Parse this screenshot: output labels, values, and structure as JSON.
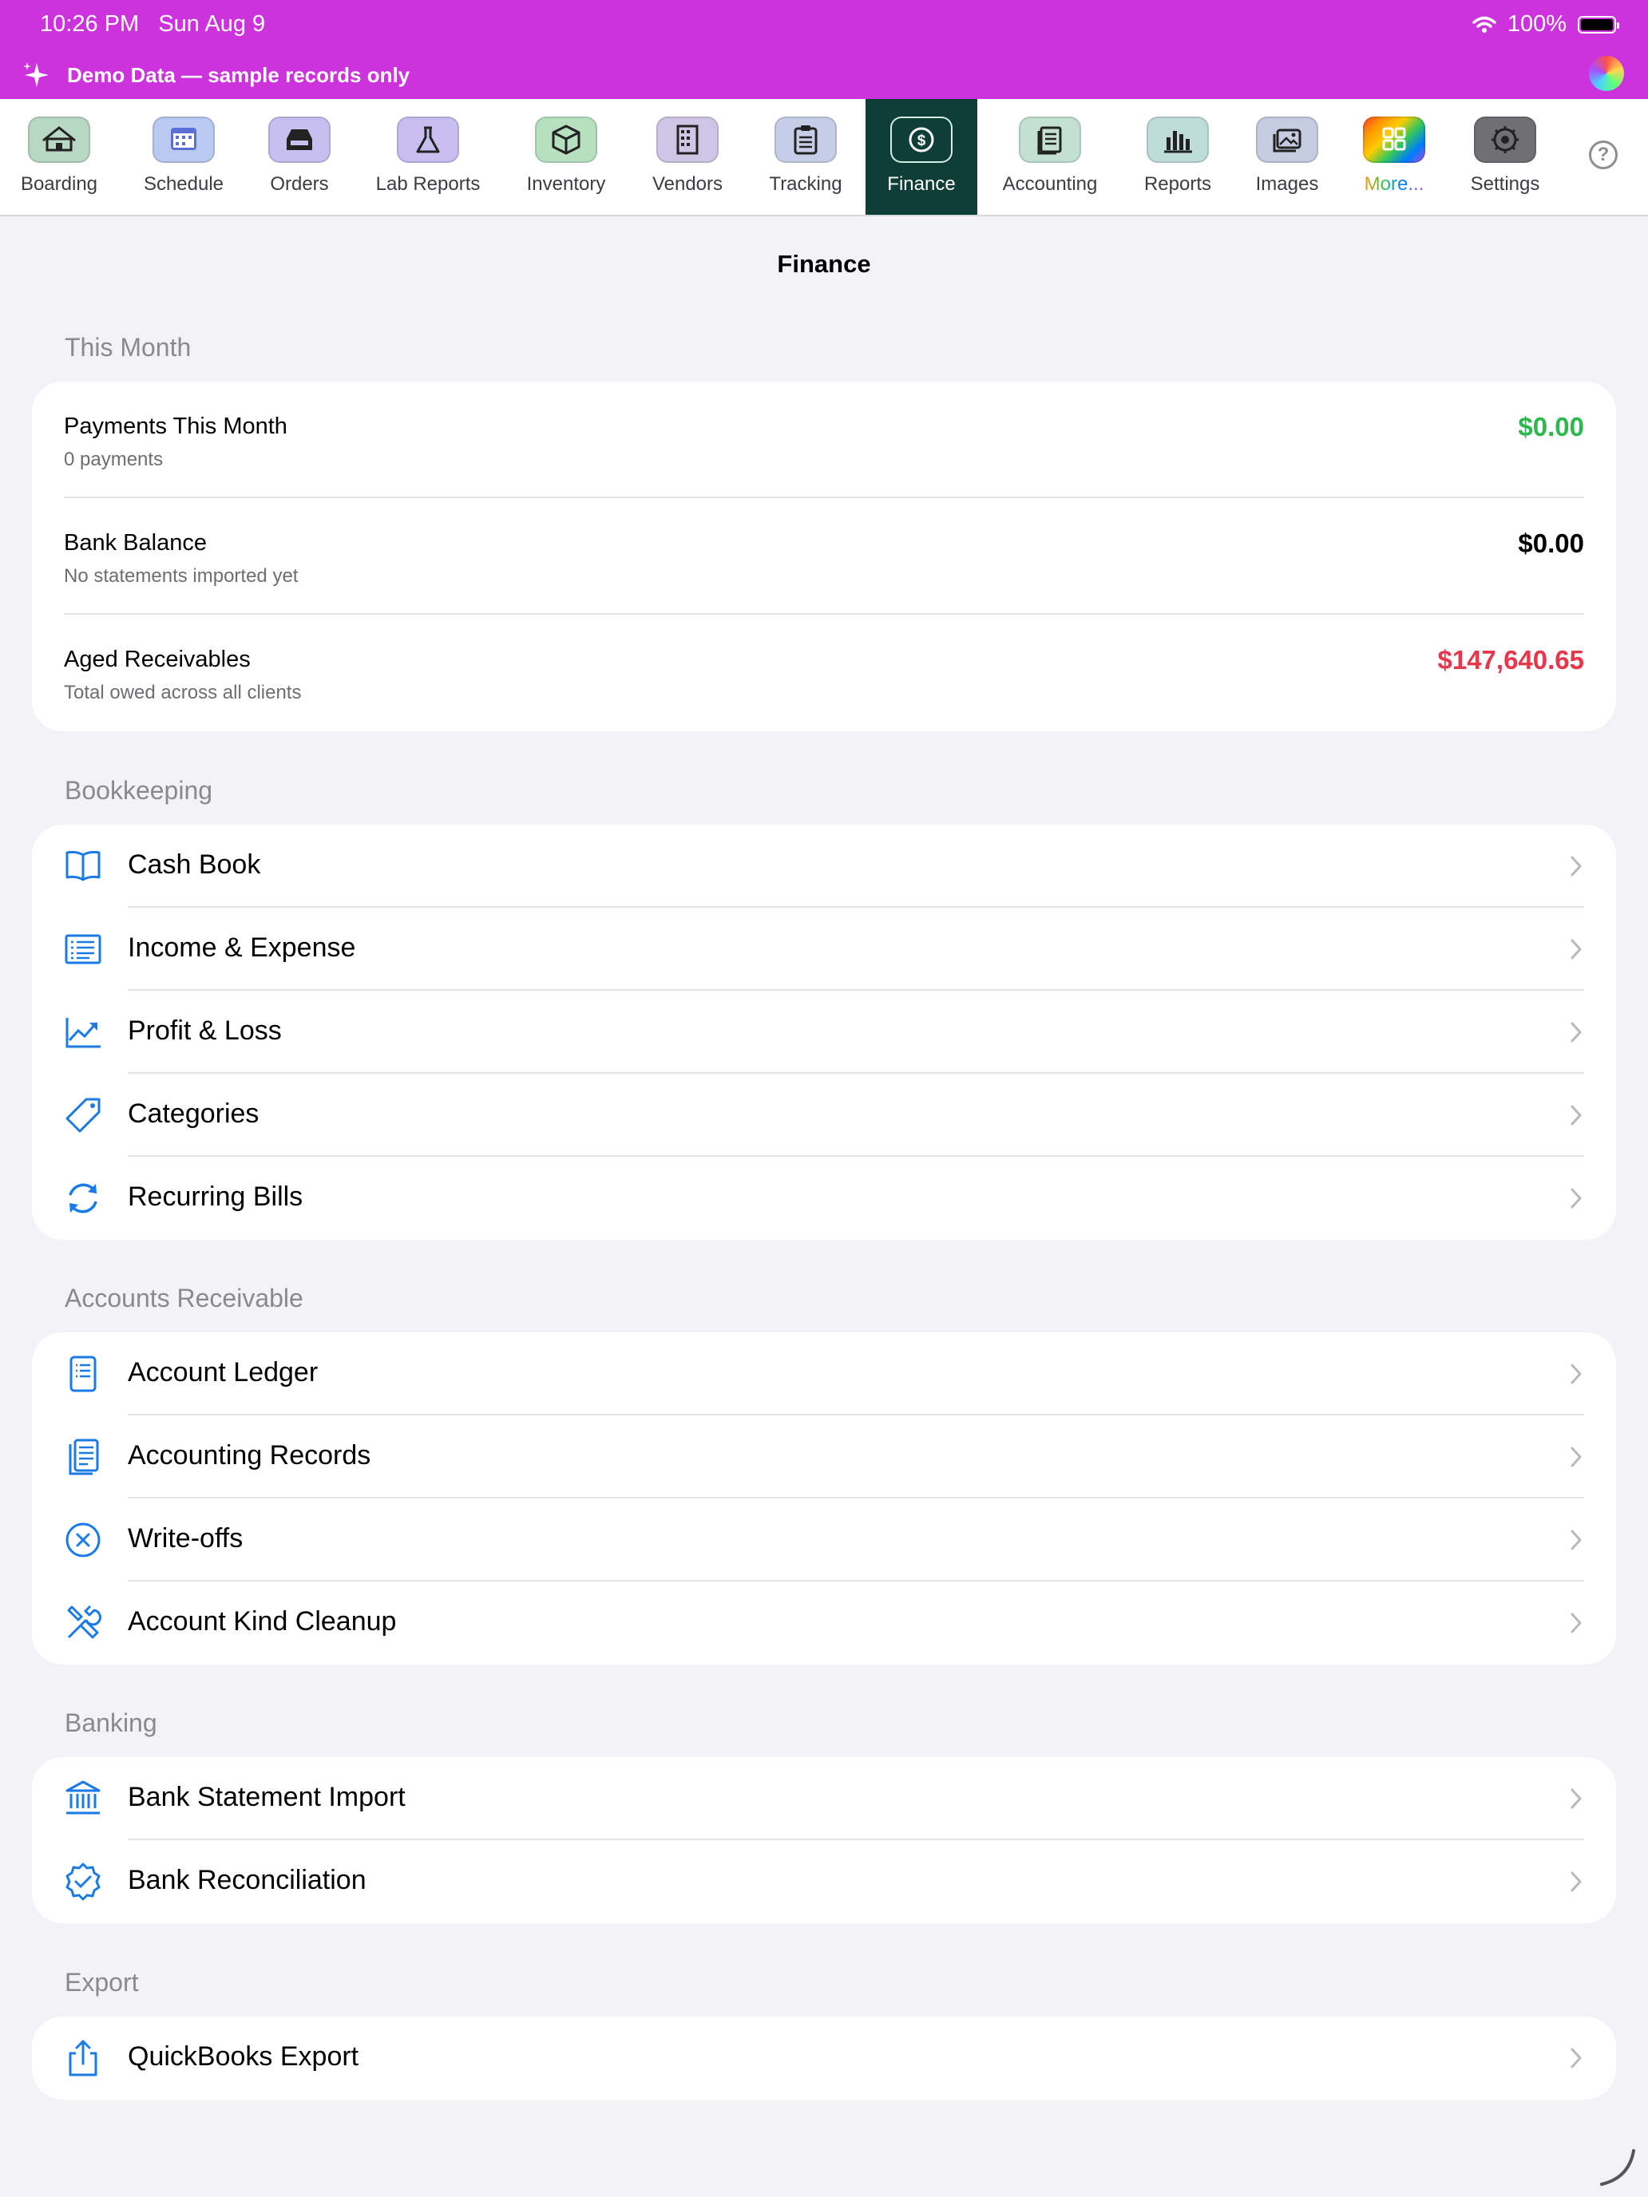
{
  "status": {
    "time": "10:26 PM",
    "date": "Sun Aug 9",
    "battery": "100%"
  },
  "demo_banner": {
    "text": "Demo Data — sample records only"
  },
  "toolbar": {
    "active": "Finance",
    "tabs": [
      {
        "label": "Boarding",
        "icon": "house-icon",
        "tint": "#b9d8c4"
      },
      {
        "label": "Schedule",
        "icon": "calendar-icon",
        "tint": "#b9c9ef"
      },
      {
        "label": "Orders",
        "icon": "tray-icon",
        "tint": "#c7c0ee"
      },
      {
        "label": "Lab Reports",
        "icon": "flask-icon",
        "tint": "#c8bff0"
      },
      {
        "label": "Inventory",
        "icon": "box-icon",
        "tint": "#b7e0c1"
      },
      {
        "label": "Vendors",
        "icon": "building-icon",
        "tint": "#cfc6e6"
      },
      {
        "label": "Tracking",
        "icon": "clipboard-icon",
        "tint": "#c6cde6"
      },
      {
        "label": "Finance",
        "icon": "dollar-icon",
        "tint": "#d3eee6"
      },
      {
        "label": "Accounting",
        "icon": "ledger-icon",
        "tint": "#c3e0d3"
      },
      {
        "label": "Reports",
        "icon": "bar-chart-icon",
        "tint": "#bfdcdb"
      },
      {
        "label": "Images",
        "icon": "photos-icon",
        "tint": "#c5cbe0"
      },
      {
        "label": "More...",
        "icon": "grid-icon",
        "tint": "rainbow"
      },
      {
        "label": "Settings",
        "icon": "gear-icon",
        "tint": "#6f6f74"
      }
    ],
    "help_icon": "question-circle-icon"
  },
  "page_title": "Finance",
  "colors": {
    "accent": "#1a7be6",
    "positive": "#2db84f",
    "negative": "#e8364b",
    "active_tab": "#0f3d37",
    "banner": "#cc33dc"
  },
  "this_month": {
    "header": "This Month",
    "rows": [
      {
        "title": "Payments This Month",
        "subtitle": "0 payments",
        "value": "$0.00",
        "value_color": "#2db84f"
      },
      {
        "title": "Bank Balance",
        "subtitle": "No statements imported yet",
        "value": "$0.00",
        "value_color": "#000000"
      },
      {
        "title": "Aged Receivables",
        "subtitle": "Total owed across all clients",
        "value": "$147,640.65",
        "value_color": "#e8364b"
      }
    ]
  },
  "bookkeeping": {
    "header": "Bookkeeping",
    "items": [
      {
        "label": "Cash Book",
        "icon": "book-icon"
      },
      {
        "label": "Income & Expense",
        "icon": "list-icon"
      },
      {
        "label": "Profit & Loss",
        "icon": "trend-up-icon"
      },
      {
        "label": "Categories",
        "icon": "tag-icon"
      },
      {
        "label": "Recurring Bills",
        "icon": "repeat-icon"
      }
    ]
  },
  "receivable": {
    "header": "Accounts Receivable",
    "items": [
      {
        "label": "Account Ledger",
        "icon": "ledger-book-icon"
      },
      {
        "label": "Accounting Records",
        "icon": "records-icon"
      },
      {
        "label": "Write-offs",
        "icon": "x-circle-icon"
      },
      {
        "label": "Account Kind Cleanup",
        "icon": "wrench-icon"
      }
    ]
  },
  "banking": {
    "header": "Banking",
    "items": [
      {
        "label": "Bank Statement Import",
        "icon": "bank-icon"
      },
      {
        "label": "Bank Reconciliation",
        "icon": "seal-check-icon"
      }
    ]
  },
  "export": {
    "header": "Export",
    "items": [
      {
        "label": "QuickBooks Export",
        "icon": "share-icon"
      }
    ]
  }
}
